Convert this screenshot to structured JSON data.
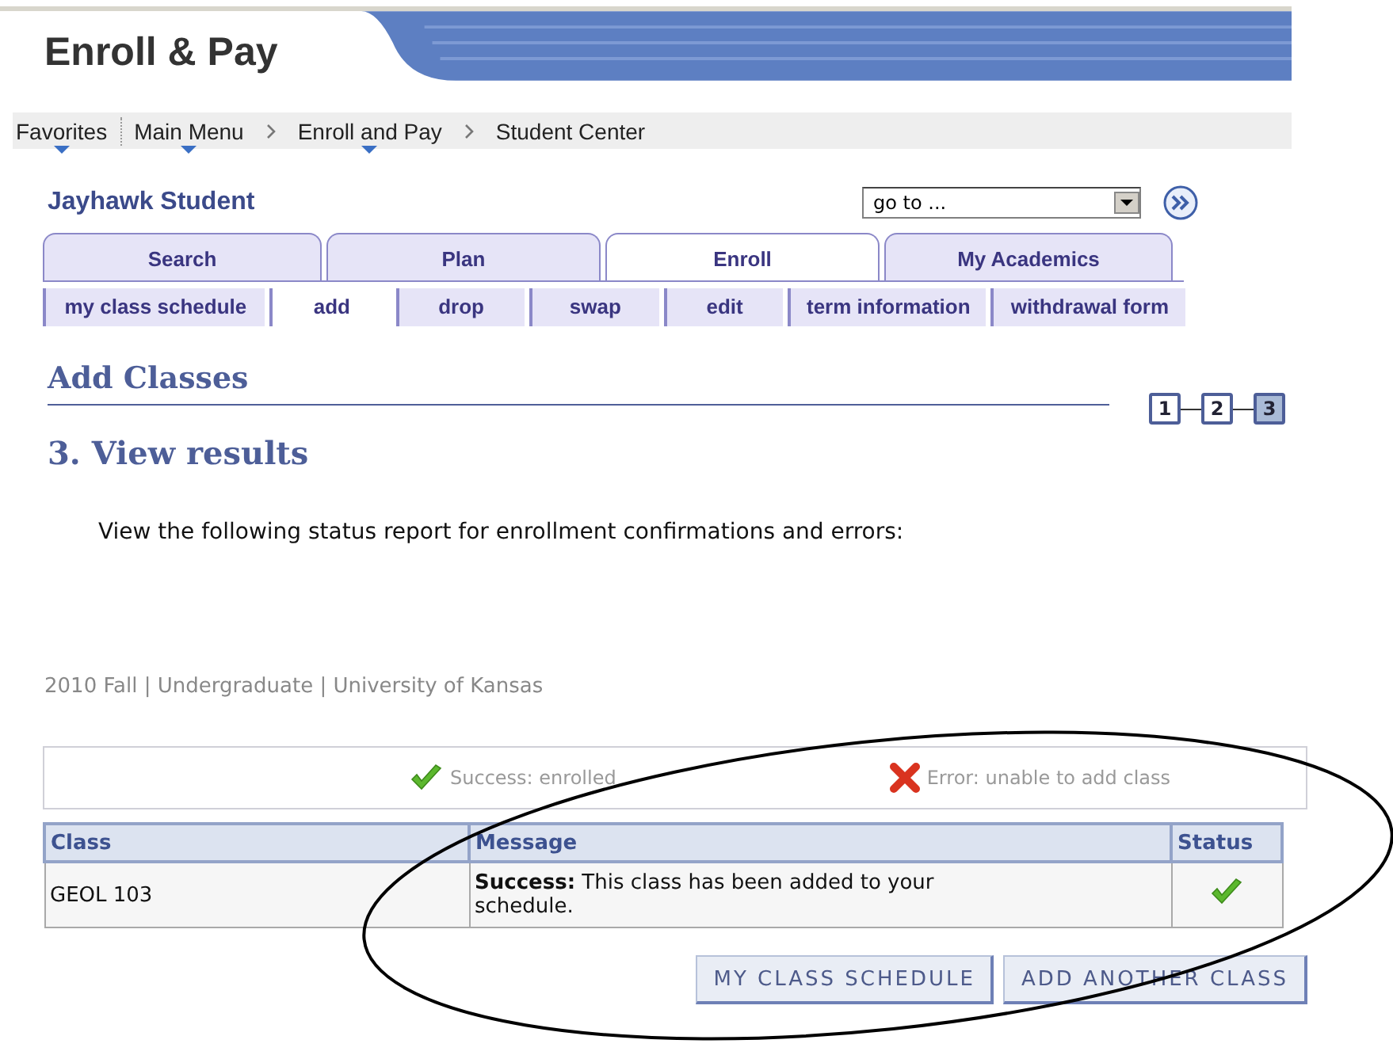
{
  "header": {
    "title": "Enroll & Pay"
  },
  "breadcrumb": [
    {
      "label": "Favorites",
      "menu": true
    },
    {
      "label": "Main Menu",
      "menu": true
    },
    {
      "label": "Enroll and Pay",
      "menu": true
    },
    {
      "label": "Student Center",
      "menu": false
    }
  ],
  "student": "Jayhawk Student",
  "goto": {
    "value": "go to ..."
  },
  "tabs": [
    {
      "label": "Search",
      "selected": false
    },
    {
      "label": "Plan",
      "selected": false
    },
    {
      "label": "Enroll",
      "selected": true
    },
    {
      "label": "My Academics",
      "selected": false
    }
  ],
  "subtabs": [
    {
      "label": "my class schedule",
      "selected": false
    },
    {
      "label": "add",
      "selected": true
    },
    {
      "label": "drop",
      "selected": false
    },
    {
      "label": "swap",
      "selected": false
    },
    {
      "label": "edit",
      "selected": false
    },
    {
      "label": "term information",
      "selected": false
    },
    {
      "label": "withdrawal form",
      "selected": false
    }
  ],
  "section_title": "Add Classes",
  "steps": [
    {
      "label": "1",
      "selected": false
    },
    {
      "label": "2",
      "selected": false
    },
    {
      "label": "3",
      "selected": true
    }
  ],
  "step_title": "3.  View results",
  "instructions": "View the following status report for enrollment confirmations and errors:",
  "term": "2010 Fall | Undergraduate | University of Kansas",
  "legend": [
    {
      "kind": "success",
      "label": "Success: enrolled"
    },
    {
      "kind": "error",
      "label": "Error: unable to add class"
    }
  ],
  "table": {
    "columns": [
      "Class",
      "Message",
      "Status"
    ],
    "rows": [
      {
        "class": "GEOL  103",
        "message": "**Success:** This class has been added to your schedule.",
        "kind": "success"
      }
    ]
  },
  "buttons": [
    "MY CLASS SCHEDULE",
    "ADD ANOTHER CLASS"
  ]
}
